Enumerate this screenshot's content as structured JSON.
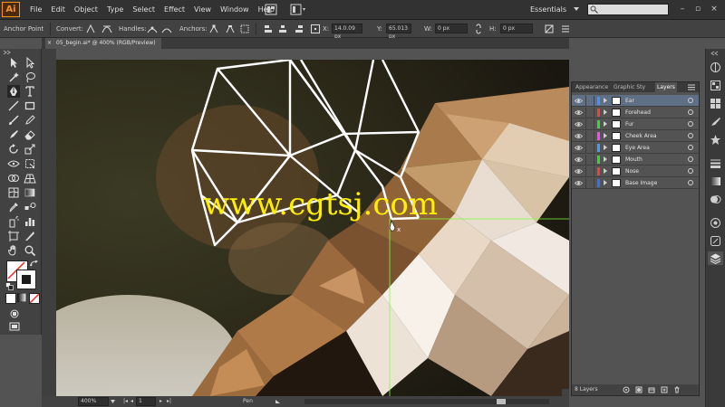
{
  "app": {
    "logo": "Ai",
    "menus": [
      "File",
      "Edit",
      "Object",
      "Type",
      "Select",
      "Effect",
      "View",
      "Window",
      "Help"
    ],
    "workspace": "Essentials",
    "search_placeholder": ""
  },
  "control_bar": {
    "tool_name": "Anchor Point",
    "convert_label": "Convert:",
    "handles_label": "Handles:",
    "anchors_label": "Anchors:",
    "x_value": "14.0.09 px",
    "y_value": "65.013 px",
    "w_value": "0 px",
    "h_value": "0 px"
  },
  "document": {
    "tab_title": "05_begin.ai* @ 400% (RGB/Preview)",
    "close": "×"
  },
  "canvas": {
    "watermark": "www.cgtsj.com"
  },
  "status_bar": {
    "zoom": "400%",
    "artboard": "1",
    "tool": "Pen"
  },
  "layers_panel": {
    "tabs": [
      "Appearance",
      "Graphic Sty",
      "Layers"
    ],
    "active_tab": "Layers",
    "layers": [
      {
        "name": "Ear",
        "color": "#4f8cff",
        "selected": true
      },
      {
        "name": "Forehead",
        "color": "#ff3a3a",
        "selected": false
      },
      {
        "name": "Fur",
        "color": "#38d838",
        "selected": false
      },
      {
        "name": "Cheek Area",
        "color": "#ff44ff",
        "selected": false
      },
      {
        "name": "Eye Area",
        "color": "#3aa0ff",
        "selected": false
      },
      {
        "name": "Mouth",
        "color": "#34d43a",
        "selected": false
      },
      {
        "name": "Nose",
        "color": "#ff3a3a",
        "selected": false
      },
      {
        "name": "Base Image",
        "color": "#3a6cff",
        "selected": false
      }
    ],
    "layer_count": "8 Layers"
  },
  "colors": {
    "accent": "#f7931e",
    "path_stroke": "#ffffff",
    "guide": "#7cff3a",
    "watermark": "#ffee00"
  }
}
